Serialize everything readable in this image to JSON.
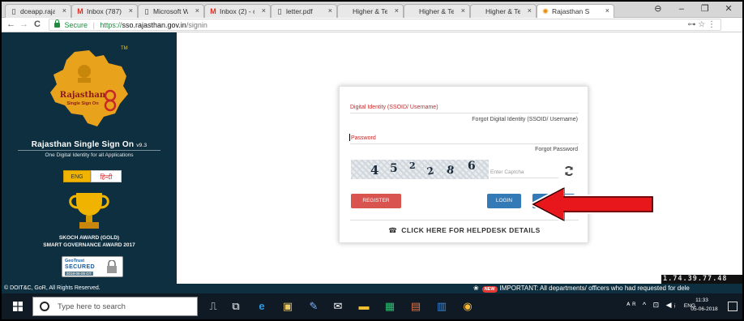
{
  "browser": {
    "tabs": [
      {
        "label": "dceapp.raja",
        "icon": "doc"
      },
      {
        "label": "Inbox (787)",
        "icon": "gmail"
      },
      {
        "label": "Microsoft W",
        "icon": "doc"
      },
      {
        "label": "Inbox (2) - o",
        "icon": "gmail"
      },
      {
        "label": "letter.pdf",
        "icon": "doc"
      },
      {
        "label": "Higher & Te",
        "icon": "none"
      },
      {
        "label": "Higher & Te",
        "icon": "none"
      },
      {
        "label": "Higher & Te",
        "icon": "none"
      },
      {
        "label": "Rajasthan S",
        "icon": "rajasthan",
        "active": true
      }
    ],
    "close_glyph": "×",
    "window_controls": {
      "profile": "⊖",
      "minimize": "–",
      "restore": "❐",
      "close": "✕"
    },
    "nav": {
      "back": "←",
      "forward": "→",
      "reload": "C"
    },
    "address": {
      "secure_label": "Secure",
      "separator": "|",
      "scheme": "https://",
      "host": "sso.rajasthan.gov.in",
      "path": "/signin",
      "right_icons": "⊶ ☆ ⋮"
    }
  },
  "sidebar": {
    "logo_tm": "TM",
    "logo_word1": "Rajasthan",
    "logo_word2": "Single Sign On",
    "title": "Rajasthan Single Sign On",
    "version": "v9.3",
    "tagline": "One Digital Identity for all Applications",
    "lang_eng": "ENG",
    "lang_hindi": "हिन्दी",
    "award_line1": "SKOCH AWARD (GOLD)",
    "award_line2": "SMART GOVERNANCE AWARD 2017",
    "geotrust_brand": "GeoTrust",
    "geotrust_secured": "SECURED",
    "geotrust_date": "2018-06-05 GT"
  },
  "login": {
    "ssoid_label": "Digital Identity (SSOID/ Username)",
    "forgot_ssoid": "Forgot Digital Identity (SSOID/ Username)",
    "password_label": "Password",
    "forgot_password": "Forgot Password",
    "captcha_chars": [
      "4",
      "5",
      "2",
      "2",
      "8",
      "6"
    ],
    "captcha_placeholder": "Enter Captcha",
    "register": "REGISTER",
    "login_btn": "LOGIN",
    "cancel": "CANCEL",
    "cancel_visible": "CAN",
    "helpdesk": "CLICK HERE FOR HELPDESK DETAILS",
    "phone_glyph": "☎"
  },
  "footer": {
    "copyright": "© DOIT&C, GoR, All Rights Reserved.",
    "flower_glyph": "❀",
    "new_badge": "NEW",
    "important": "IMPORTANT: All departments/ officers who had requested for dele"
  },
  "ip_address": "1.74.39.77.48",
  "taskbar": {
    "search_placeholder": "Type here to search",
    "tray_symbols": "ᴬᴿ  ^  ⊡  ◀ᵢ",
    "tray_lang": "ENG",
    "time": "11:33",
    "date": "05-06-2018"
  },
  "colors": {
    "sidebar_bg": "#0e2f3f",
    "accent_red": "#c62828",
    "register_red": "#d9534f",
    "button_blue": "#337ab7",
    "arrow_red": "#e8171b"
  }
}
